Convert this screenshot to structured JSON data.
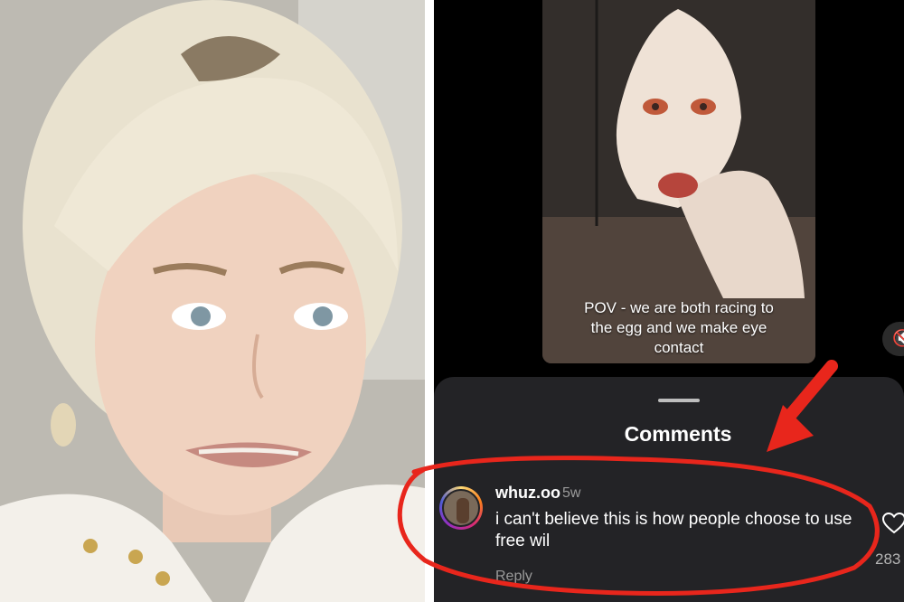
{
  "video": {
    "caption": "POV - we are both racing to the egg and we make eye contact"
  },
  "comments_sheet": {
    "title": "Comments",
    "comment": {
      "username": "whuz.oo",
      "time": "5w",
      "text": "i can't believe this is how people choose to use free wil",
      "reply_label": "Reply",
      "like_count": "283"
    }
  },
  "icons": {
    "mute": "speaker-muted-icon",
    "like": "heart-outline-icon",
    "annotation": "red-arrow"
  },
  "colors": {
    "annotation_red": "#e8261c",
    "sheet_background": "#232326",
    "text_primary": "#ffffff",
    "text_secondary": "#9a9a9a"
  }
}
